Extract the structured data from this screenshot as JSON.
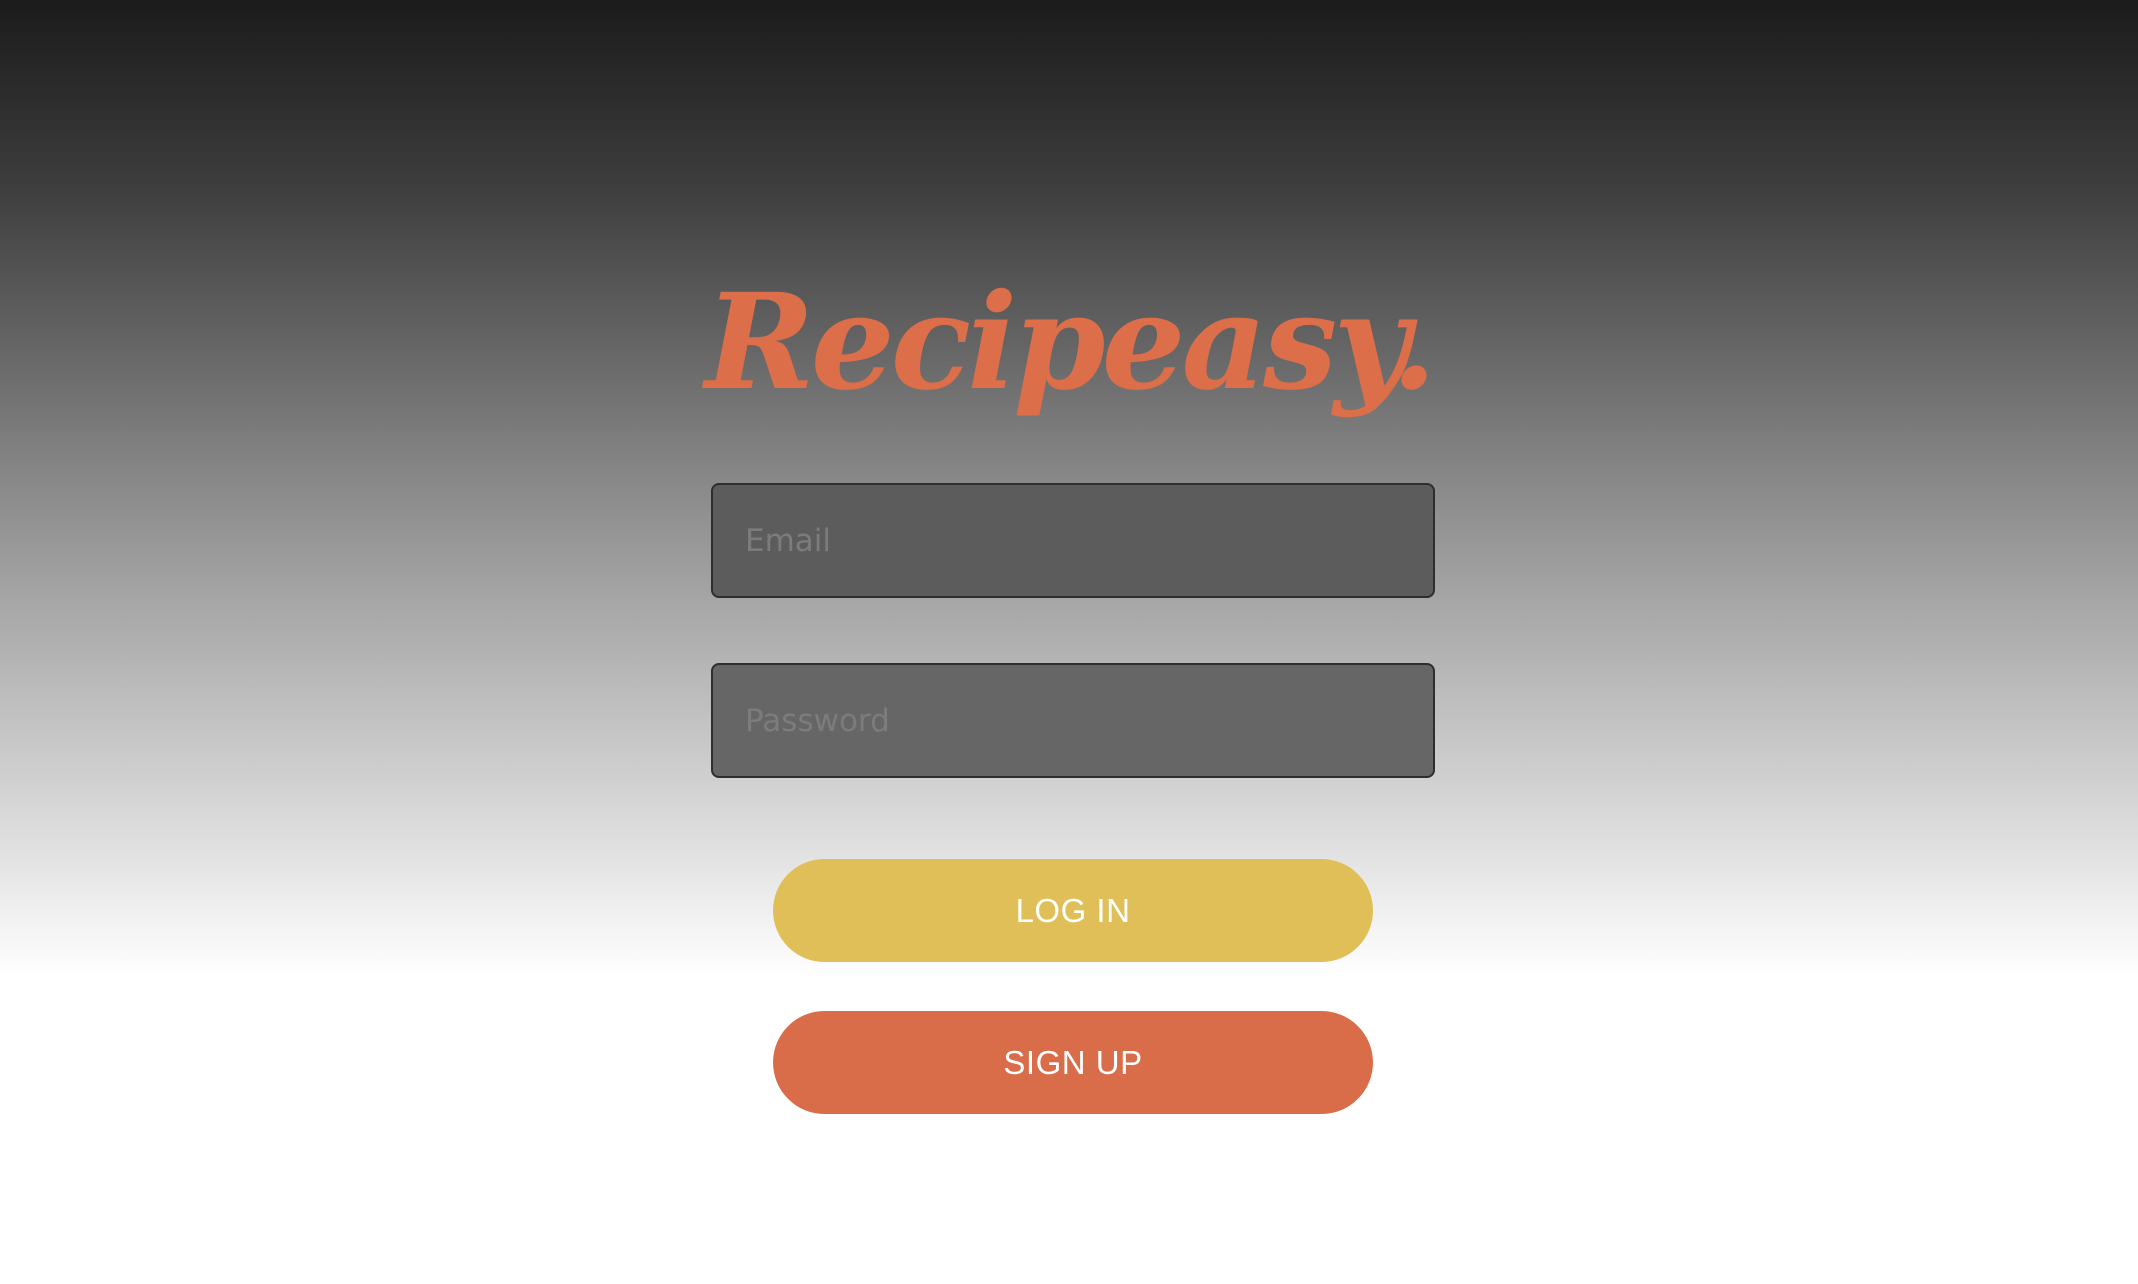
{
  "app": {
    "logo": "Recipeasy."
  },
  "form": {
    "email_placeholder": "Email",
    "password_placeholder": "Password",
    "login_label": "LOG IN",
    "signup_label": "SIGN UP"
  },
  "colors": {
    "brand": "#dc6e4a",
    "login_button": "#e0bf58",
    "signup_button": "#d96d4a",
    "gradient_top": "#1b1b1b",
    "gradient_bottom": "#ffffff"
  }
}
